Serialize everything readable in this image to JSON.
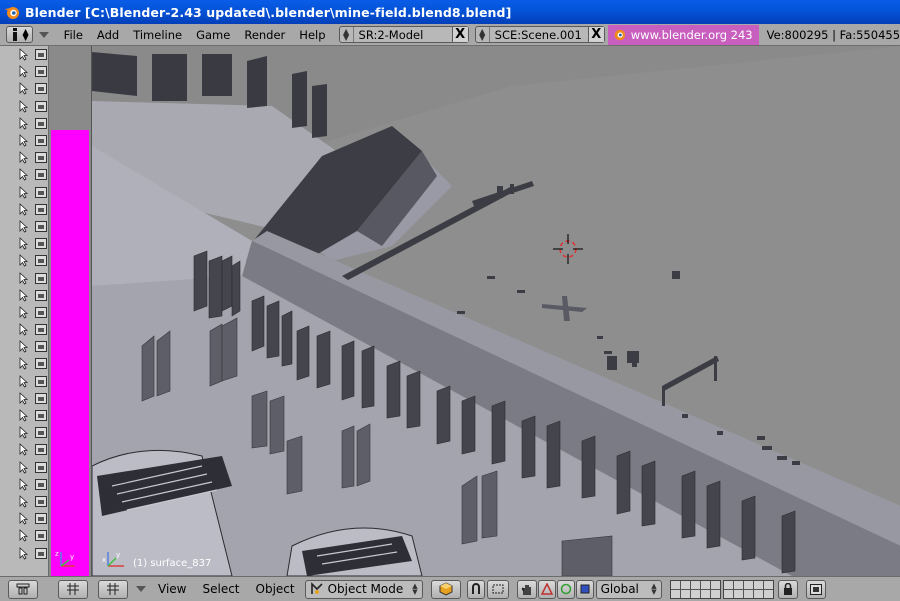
{
  "window": {
    "title": "Blender [C:\\Blender-2.43 updated\\.blender\\mine-field.blend8.blend]",
    "icon": "blender-logo-icon"
  },
  "info_header": {
    "menus": [
      "File",
      "Add",
      "Timeline",
      "Game",
      "Render",
      "Help"
    ],
    "screen_field": "SR:2-Model",
    "scene_field": "SCE:Scene.001",
    "url": "www.blender.org 243",
    "stats": "Ve:800295 | Fa:550455",
    "close_label": "X",
    "accent_color": "#c85fbf"
  },
  "outliner": {
    "row_count": 30,
    "row_icons": [
      "cursor-icon",
      "image-icon"
    ]
  },
  "left_panel": {
    "fill_color": "#ff00ff"
  },
  "viewport": {
    "object_label": "(1) surface_837",
    "axis_labels": [
      "x",
      "y",
      "z"
    ]
  },
  "bottom_header": {
    "menus": [
      "View",
      "Select",
      "Object"
    ],
    "mode": "Object Mode",
    "orientation": "Global"
  }
}
